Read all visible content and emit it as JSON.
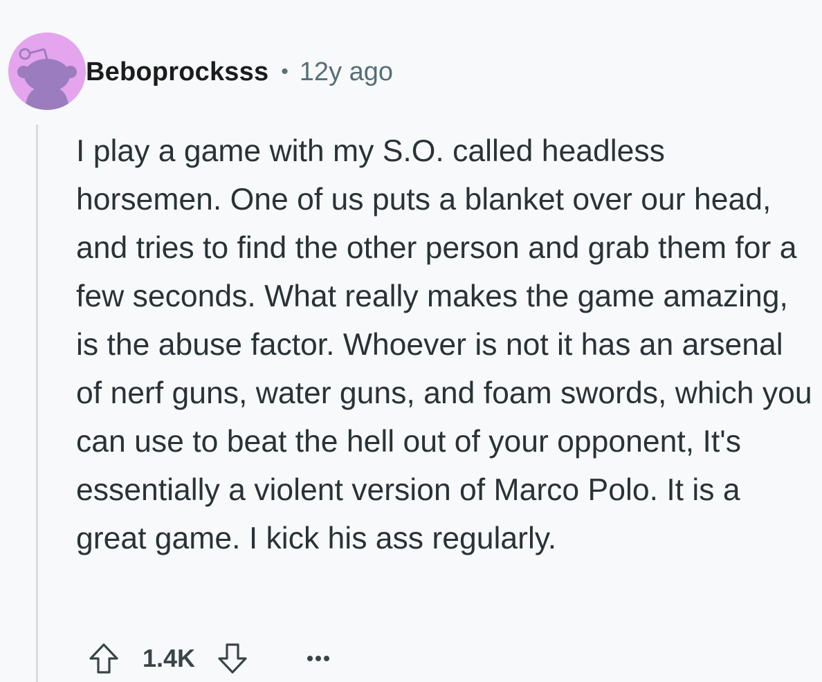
{
  "comment": {
    "author": "Beboprocksss",
    "separator": "•",
    "age": "12y ago",
    "text": "I play a game with my S.O. called headless horsemen. One of us puts a blanket over our head, and tries to find the other person and grab them for a few seconds. What really makes the game amazing, is the abuse factor. Whoever is not it has an arsenal of nerf guns, water guns, and foam swords, which you can use to beat the hell out of your opponent, It's essentially a violent version of Marco Polo. It is a great game. I kick his ass regularly.",
    "score": "1.4K"
  },
  "icons": {
    "avatar": "snoo-avatar-icon",
    "upvote": "arrow-up-icon",
    "downvote": "arrow-down-icon",
    "more": "more-options-icon"
  },
  "colors": {
    "background": "#f7f9fa",
    "avatar_bg": "#e4a5ee",
    "avatar_figure": "#9b7dbf",
    "thread_line": "#d6dde0",
    "meta_text": "#576f76"
  }
}
